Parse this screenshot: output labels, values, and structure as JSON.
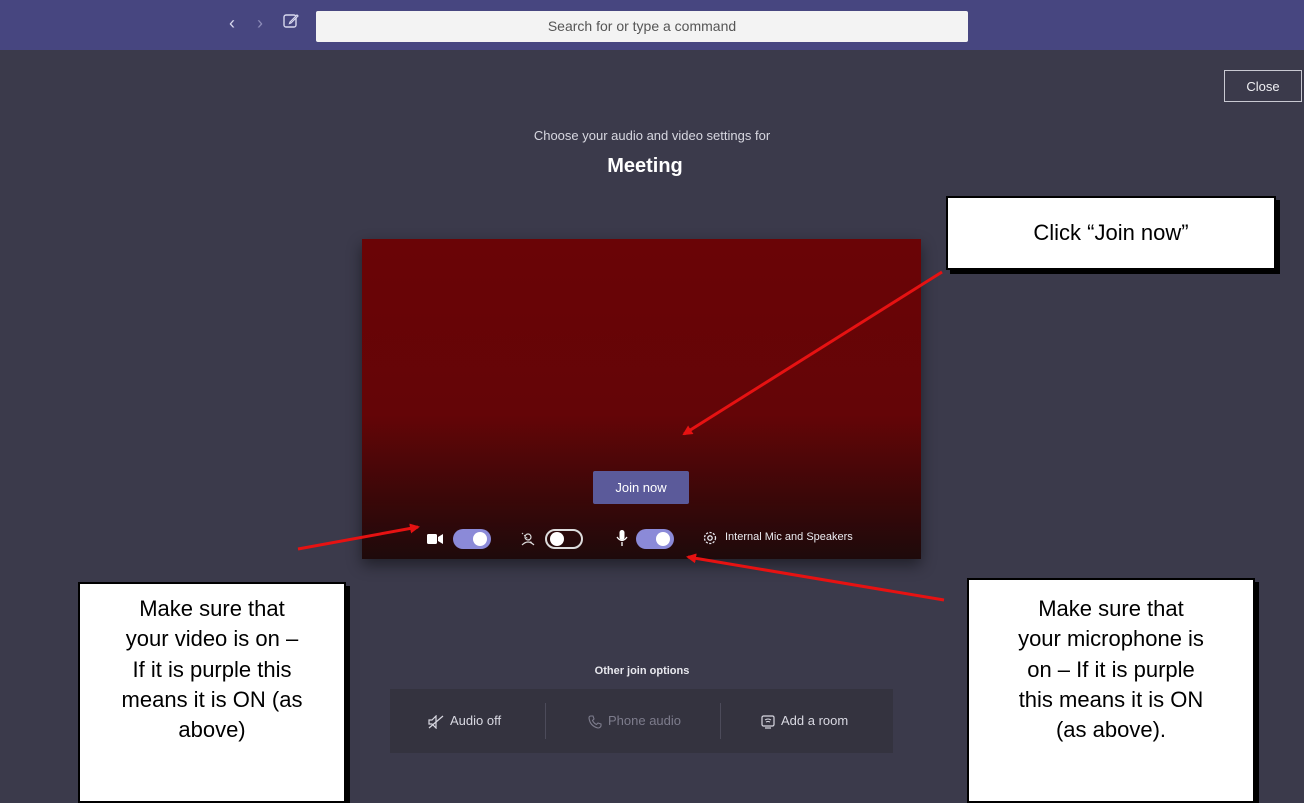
{
  "search": {
    "placeholder": "Search for or type a command"
  },
  "header": {
    "close_label": "Close"
  },
  "prejoin": {
    "subtitle": "Choose your audio and video settings for",
    "meeting_title": "Meeting",
    "join_label": "Join now",
    "video_on": true,
    "blur_on": false,
    "mic_on": true,
    "device_label": "Internal Mic and Speakers"
  },
  "other_options": {
    "heading": "Other join options",
    "items": [
      {
        "label": "Audio off",
        "icon": "speaker-off-icon"
      },
      {
        "label": "Phone audio",
        "icon": "phone-icon"
      },
      {
        "label": "Add a room",
        "icon": "room-icon"
      }
    ]
  },
  "annotations": {
    "join": "Click “Join now”",
    "video": [
      "Make sure that",
      "your video is on –",
      "If it is purple this",
      "means it is ON (as",
      "above)"
    ],
    "mic": [
      "Make sure that",
      "your microphone is",
      "on – If it is purple",
      "this means it is ON",
      "(as above)."
    ]
  },
  "colors": {
    "topbar": "#474680",
    "toggle_on": "#8b8ad8",
    "join_button": "#5b5a9a",
    "arrow": "#e61212"
  }
}
